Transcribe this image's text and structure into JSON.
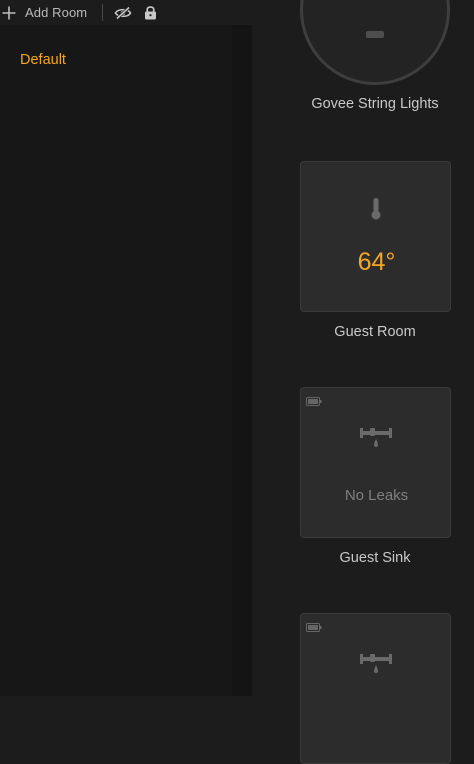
{
  "toolbar": {
    "add_room_label": "Add Room",
    "icons": [
      "plus-icon",
      "eye-off-icon",
      "lock-icon"
    ]
  },
  "sidebar": {
    "rooms": [
      {
        "label": "Default",
        "selected": true
      }
    ]
  },
  "accessories": [
    {
      "name": "Govee String Lights",
      "kind": "light",
      "icon": "light-dial"
    },
    {
      "name": "Guest Room",
      "kind": "temperature-sensor",
      "value": "64°",
      "icon": "thermometer-icon"
    },
    {
      "name": "Guest Sink",
      "kind": "leak-sensor",
      "status": "No Leaks",
      "icon": "leak-sensor-icon",
      "battery_icon": "battery-icon"
    },
    {
      "name": "",
      "kind": "leak-sensor",
      "icon": "leak-sensor-icon",
      "battery_icon": "battery-icon"
    }
  ],
  "colors": {
    "accent": "#f5a623",
    "background": "#1c1c1c",
    "sidebar": "#171717",
    "tile": "#2c2c2c",
    "label": "#c9c9c9"
  }
}
